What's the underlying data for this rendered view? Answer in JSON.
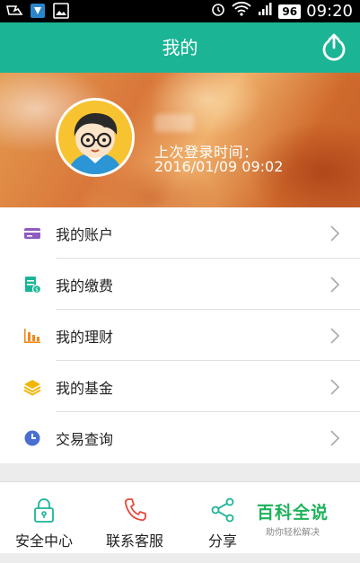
{
  "status_bar": {
    "icons_left": [
      "notification-icon-1",
      "notification-icon-2",
      "image-icon"
    ],
    "battery": "96",
    "time": "09:20"
  },
  "appbar": {
    "title": "我的"
  },
  "profile": {
    "login_label": "上次登录时间：",
    "login_time": "2016/01/09 09:02"
  },
  "menu": [
    {
      "label": "我的账户",
      "icon": "card-icon",
      "color": "#8e5bbf"
    },
    {
      "label": "我的缴费",
      "icon": "bill-icon",
      "color": "#1bb596"
    },
    {
      "label": "我的理财",
      "icon": "bar-chart-icon",
      "color": "#f08a1d"
    },
    {
      "label": "我的基金",
      "icon": "stack-icon",
      "color": "#f2b500"
    },
    {
      "label": "交易查询",
      "icon": "clock-icon",
      "color": "#4a6fd1"
    }
  ],
  "bottom_nav": [
    {
      "label": "安全中心",
      "icon": "lock-icon"
    },
    {
      "label": "联系客服",
      "icon": "phone-icon"
    },
    {
      "label": "分享",
      "icon": "share-icon"
    }
  ],
  "watermark": {
    "title": "百科全说",
    "subtitle": "助你轻松解决"
  },
  "colors": {
    "primary": "#1bb596",
    "icon_teal": "#1bb596",
    "phone_red": "#e64a3b"
  }
}
